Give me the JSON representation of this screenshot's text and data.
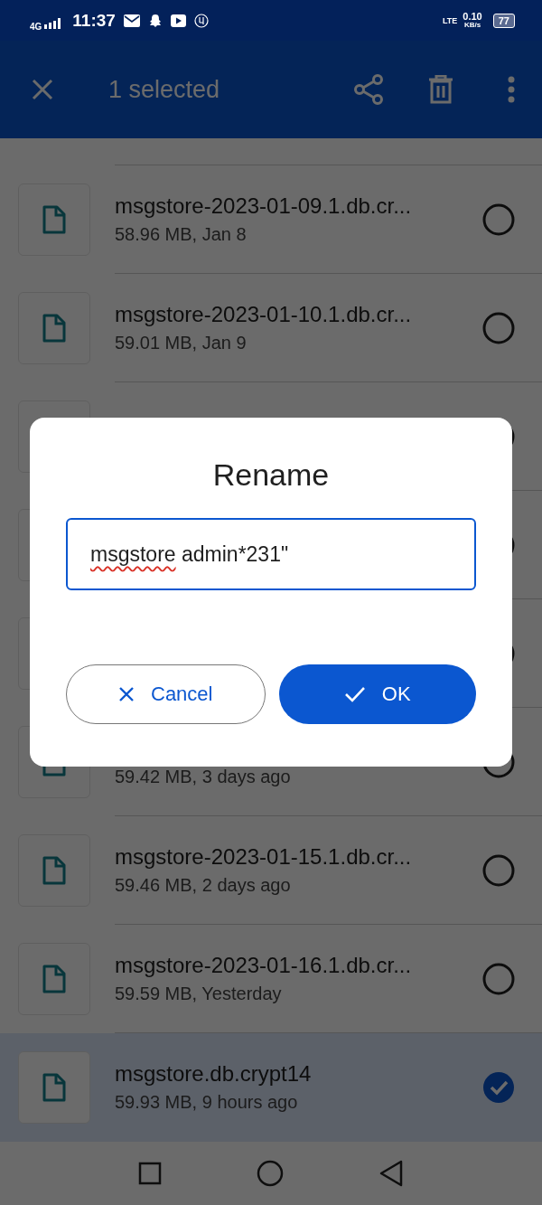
{
  "status_bar": {
    "network": "4G",
    "time": "11:37",
    "lte": "LTE",
    "speed": "0.10",
    "speed_unit": "KB/s",
    "battery": "77"
  },
  "app_bar": {
    "title": "1 selected"
  },
  "files": [
    {
      "title": "msgstore-2023-01-09.1.db.cr...",
      "subtitle": "58.96 MB, Jan 8",
      "selected": false
    },
    {
      "title": "msgstore-2023-01-10.1.db.cr...",
      "subtitle": "59.01 MB, Jan 9",
      "selected": false
    },
    {
      "selected": false
    },
    {
      "selected": false
    },
    {
      "selected": false
    },
    {
      "subtitle": "59.42 MB, 3 days ago",
      "selected": false
    },
    {
      "title": "msgstore-2023-01-15.1.db.cr...",
      "subtitle": "59.46 MB, 2 days ago",
      "selected": false
    },
    {
      "title": "msgstore-2023-01-16.1.db.cr...",
      "subtitle": "59.59 MB, Yesterday",
      "selected": false
    },
    {
      "title": "msgstore.db.crypt14",
      "subtitle": "59.93 MB, 9 hours ago",
      "selected": true
    }
  ],
  "dialog": {
    "title": "Rename",
    "value_parts": [
      {
        "text": "msgstore",
        "misspelled": true
      },
      {
        "text": " admin*231\"",
        "misspelled": false
      }
    ],
    "buttons": [
      {
        "kind": "cancel",
        "label": "Cancel"
      },
      {
        "kind": "ok",
        "label": "OK"
      }
    ]
  }
}
